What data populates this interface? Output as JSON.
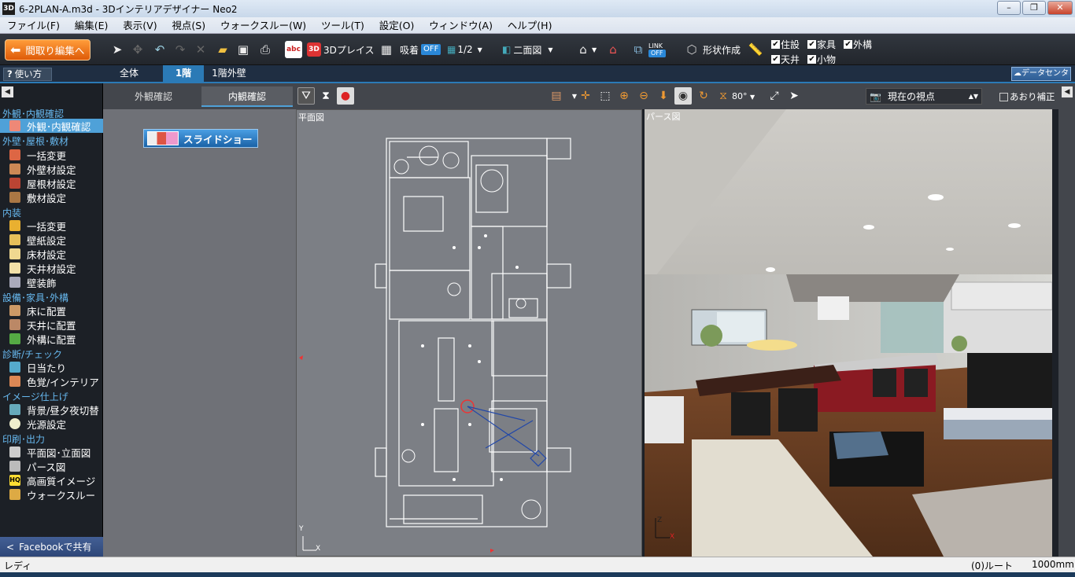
{
  "window": {
    "title": "6-2PLAN-A.m3d - 3Dインテリアデザイナー Neo2",
    "app_icon": "3D"
  },
  "menu": [
    "ファイル(F)",
    "編集(E)",
    "表示(V)",
    "視点(S)",
    "ウォークスルー(W)",
    "ツール(T)",
    "設定(O)",
    "ウィンドウ(A)",
    "ヘルプ(H)"
  ],
  "toolbar": {
    "layout_edit": "間取り編集へ",
    "place_3d": "3Dプレイス",
    "snap_label": "吸着",
    "snap_state": "OFF",
    "grid_value": "1/2",
    "view_mode": "二面図",
    "link_label": "LINK",
    "link_state": "OFF",
    "shape_create": "形状作成",
    "checks": [
      {
        "label": "住設",
        "checked": true
      },
      {
        "label": "家具",
        "checked": true
      },
      {
        "label": "外構",
        "checked": true
      },
      {
        "label": "天井",
        "checked": true
      },
      {
        "label": "小物",
        "checked": true
      }
    ]
  },
  "tabs": {
    "help": "使い方",
    "items": [
      "全体",
      "1階",
      "1階外壁"
    ],
    "active": 1,
    "data_center": "データセンター"
  },
  "sidebar": {
    "sections": [
      {
        "title": "外観･内観確認",
        "items": [
          {
            "label": "外観･内観確認",
            "icon": "house-view-icon",
            "selected": true
          }
        ]
      },
      {
        "title": "外壁･屋根･敷材",
        "items": [
          {
            "label": "一括変更",
            "icon": "bulk-change-icon"
          },
          {
            "label": "外壁材設定",
            "icon": "exterior-wall-icon"
          },
          {
            "label": "屋根材設定",
            "icon": "roof-material-icon"
          },
          {
            "label": "敷材設定",
            "icon": "paving-material-icon"
          }
        ]
      },
      {
        "title": "内装",
        "items": [
          {
            "label": "一括変更",
            "icon": "interior-bulk-icon"
          },
          {
            "label": "壁紙設定",
            "icon": "wallpaper-icon"
          },
          {
            "label": "床材設定",
            "icon": "floor-material-icon"
          },
          {
            "label": "天井材設定",
            "icon": "ceiling-material-icon"
          },
          {
            "label": "壁装飾",
            "icon": "wall-decoration-icon"
          }
        ]
      },
      {
        "title": "設備･家具･外構",
        "items": [
          {
            "label": "床に配置",
            "icon": "place-floor-icon"
          },
          {
            "label": "天井に配置",
            "icon": "place-ceiling-icon"
          },
          {
            "label": "外構に配置",
            "icon": "place-exterior-icon"
          }
        ]
      },
      {
        "title": "診断/チェック",
        "items": [
          {
            "label": "日当たり",
            "icon": "sunlight-icon"
          },
          {
            "label": "色覚/インテリア",
            "icon": "color-vision-icon"
          }
        ]
      },
      {
        "title": "イメージ仕上げ",
        "items": [
          {
            "label": "背景/昼夕夜切替",
            "icon": "background-icon"
          },
          {
            "label": "光源設定",
            "icon": "light-source-icon"
          }
        ]
      },
      {
        "title": "印刷･出力",
        "items": [
          {
            "label": "平面図･立面図",
            "icon": "plan-print-icon"
          },
          {
            "label": "パース図",
            "icon": "perspective-print-icon"
          },
          {
            "label": "高画質イメージ",
            "icon": "hq-image-icon"
          },
          {
            "label": "ウォークスルー",
            "icon": "walkthrough-icon"
          }
        ]
      }
    ],
    "share": "Facebookで共有"
  },
  "subpanel": {
    "tabs": [
      "外観確認",
      "内観確認"
    ],
    "active": 1,
    "slideshow": "スライドショー"
  },
  "viewtools": {
    "fov": "80°",
    "viewpoint": "現在の視点",
    "tilt_correct": "あおり補正"
  },
  "views": {
    "plan_label": "平面図",
    "persp_label": "パース図",
    "axis_y": "Y",
    "axis_x": "X",
    "axis_z": "Z"
  },
  "status": {
    "left": "レディ",
    "route": "(0)ルート",
    "scale": "1000mm"
  }
}
